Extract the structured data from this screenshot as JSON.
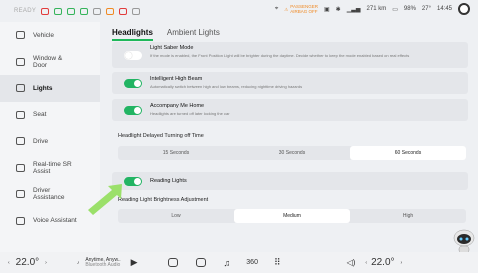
{
  "status": {
    "ready": "READY",
    "airbag_line1": "PASSENGER",
    "airbag_line2": "AIRBAG OFF",
    "range": "271 km",
    "battery": "98%",
    "outside_temp": "27°",
    "time": "14:45"
  },
  "sidebar": {
    "items": [
      {
        "label": "Vehicle"
      },
      {
        "label": "Window & Door"
      },
      {
        "label": "Lights"
      },
      {
        "label": "Seat"
      },
      {
        "label": "Drive"
      },
      {
        "label": "Real-time SR Assist"
      },
      {
        "label": "Driver Assistance"
      },
      {
        "label": "Voice Assistant"
      }
    ]
  },
  "tabs": {
    "headlights": "Headlights",
    "ambient": "Ambient Lights"
  },
  "options": {
    "light_saber": {
      "title": "Light Saber Mode",
      "desc": "If the mode is enabled, the Front Position Light will be brighter during the daytime. Decide whether to keep the mode enabled based on real effects"
    },
    "intelligent_beam": {
      "title": "Intelligent High Beam",
      "desc": "Automatically switch between high and low beams, reducing nighttime driving hazards"
    },
    "accompany_home": {
      "title": "Accompany Me Home",
      "desc": "Headlights are turned off later locking the car"
    },
    "reading_lights": {
      "title": "Reading Lights"
    }
  },
  "delay": {
    "title": "Headlight Delayed Turning off Time",
    "options": [
      "15 Seconds",
      "30 Seconds",
      "60 Seconds"
    ]
  },
  "brightness": {
    "title": "Reading Light Brightness Adjustment",
    "options": [
      "Low",
      "Medium",
      "High"
    ]
  },
  "bottom": {
    "left_temp": "22.0°",
    "right_temp": "22.0°",
    "media_title": "Anytime, Anyw..",
    "media_sub": "Bluetooth Audio"
  }
}
